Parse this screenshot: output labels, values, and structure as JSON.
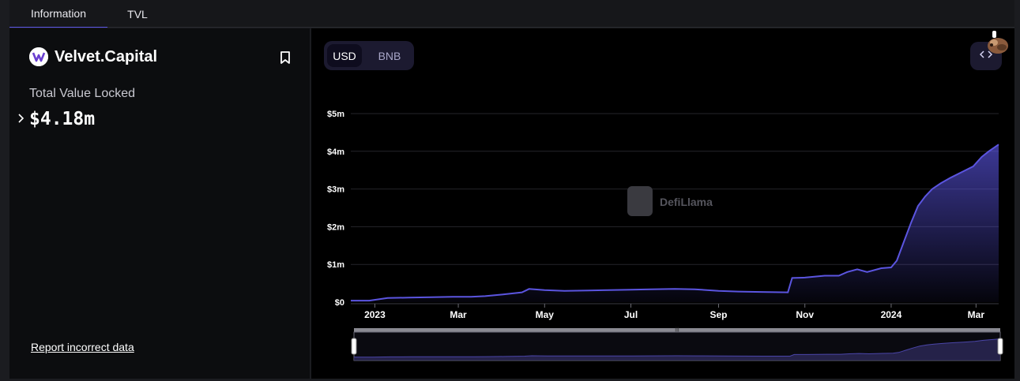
{
  "tabs": [
    {
      "label": "Information"
    },
    {
      "label": "TVL"
    }
  ],
  "protocol": {
    "name": "Velvet.Capital",
    "tvl_label": "Total Value Locked",
    "tvl_value": "$4.18m",
    "report_link": "Report incorrect data"
  },
  "chart_controls": {
    "currencies": [
      "USD",
      "BNB"
    ],
    "selected": "USD"
  },
  "watermark": "DefiLlama",
  "colors": {
    "accent": "#5d57e8",
    "line": "#5b55e0",
    "panel_bg": "#0c0d0f",
    "chart_bg": "#000000"
  },
  "icons": [
    "velvet-logo-icon",
    "bookmark-icon",
    "chevron-right-icon",
    "code-embed-icon",
    "llama-mascot-icon",
    "defillama-logo-icon"
  ],
  "chart_data": {
    "type": "area",
    "title": "",
    "xlabel": "",
    "ylabel": "",
    "y_unit": "USD",
    "ylim": [
      0,
      5000000
    ],
    "y_ticks": [
      {
        "value": 0,
        "label": "$0"
      },
      {
        "value": 1000000,
        "label": "$1m"
      },
      {
        "value": 2000000,
        "label": "$2m"
      },
      {
        "value": 3000000,
        "label": "$3m"
      },
      {
        "value": 4000000,
        "label": "$4m"
      },
      {
        "value": 5000000,
        "label": "$5m"
      }
    ],
    "x_range": [
      "2022-12-15",
      "2024-03-17"
    ],
    "x_ticks": [
      {
        "value": "2023-01-01",
        "label": "2023",
        "bold": true
      },
      {
        "value": "2023-03-01",
        "label": "Mar",
        "bold": false
      },
      {
        "value": "2023-05-01",
        "label": "May",
        "bold": false
      },
      {
        "value": "2023-07-01",
        "label": "Jul",
        "bold": false
      },
      {
        "value": "2023-09-01",
        "label": "Sep",
        "bold": false
      },
      {
        "value": "2023-11-01",
        "label": "Nov",
        "bold": false
      },
      {
        "value": "2024-01-01",
        "label": "2024",
        "bold": true
      },
      {
        "value": "2024-03-01",
        "label": "Mar",
        "bold": false
      }
    ],
    "grid": true,
    "series": [
      {
        "points": [
          [
            "2022-12-15",
            40000
          ],
          [
            "2022-12-28",
            40000
          ],
          [
            "2023-01-10",
            110000
          ],
          [
            "2023-01-25",
            120000
          ],
          [
            "2023-02-10",
            130000
          ],
          [
            "2023-02-25",
            140000
          ],
          [
            "2023-03-10",
            140000
          ],
          [
            "2023-03-20",
            160000
          ],
          [
            "2023-04-01",
            200000
          ],
          [
            "2023-04-15",
            260000
          ],
          [
            "2023-04-20",
            350000
          ],
          [
            "2023-05-01",
            320000
          ],
          [
            "2023-05-15",
            300000
          ],
          [
            "2023-06-01",
            310000
          ],
          [
            "2023-06-15",
            320000
          ],
          [
            "2023-07-01",
            330000
          ],
          [
            "2023-07-15",
            340000
          ],
          [
            "2023-08-01",
            350000
          ],
          [
            "2023-08-15",
            340000
          ],
          [
            "2023-09-01",
            300000
          ],
          [
            "2023-09-15",
            280000
          ],
          [
            "2023-10-01",
            270000
          ],
          [
            "2023-10-20",
            260000
          ],
          [
            "2023-10-23",
            640000
          ],
          [
            "2023-11-01",
            650000
          ],
          [
            "2023-11-15",
            700000
          ],
          [
            "2023-11-25",
            700000
          ],
          [
            "2023-12-01",
            800000
          ],
          [
            "2023-12-08",
            870000
          ],
          [
            "2023-12-15",
            800000
          ],
          [
            "2023-12-25",
            900000
          ],
          [
            "2024-01-01",
            920000
          ],
          [
            "2024-01-05",
            1100000
          ],
          [
            "2024-01-10",
            1600000
          ],
          [
            "2024-01-15",
            2100000
          ],
          [
            "2024-01-20",
            2550000
          ],
          [
            "2024-01-25",
            2800000
          ],
          [
            "2024-01-30",
            3000000
          ],
          [
            "2024-02-05",
            3150000
          ],
          [
            "2024-02-12",
            3300000
          ],
          [
            "2024-02-20",
            3450000
          ],
          [
            "2024-02-28",
            3600000
          ],
          [
            "2024-03-05",
            3850000
          ],
          [
            "2024-03-10",
            4000000
          ],
          [
            "2024-03-17",
            4180000
          ]
        ]
      }
    ]
  }
}
